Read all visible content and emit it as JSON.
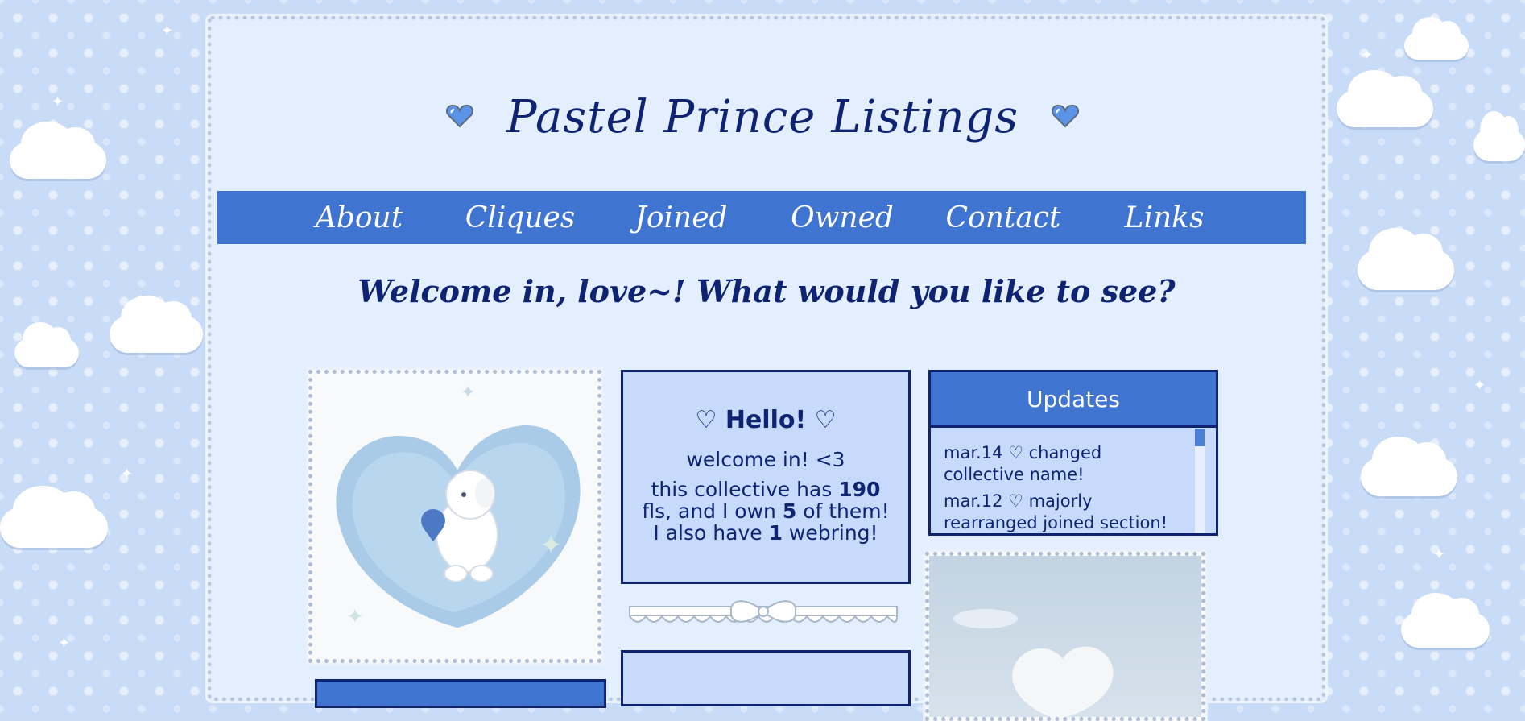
{
  "site": {
    "title": "Pastel Prince Listings"
  },
  "nav": {
    "items": [
      {
        "label": "About"
      },
      {
        "label": "Cliques"
      },
      {
        "label": "Joined"
      },
      {
        "label": "Owned"
      },
      {
        "label": "Contact"
      },
      {
        "label": "Links"
      }
    ]
  },
  "welcome": {
    "text": "Welcome in, love~! What would you like to see?"
  },
  "hello": {
    "title": "♡ Hello! ♡",
    "line1": "welcome in! <3",
    "stats_prefix": "this collective has ",
    "fls_count": "190",
    "stats_mid1": " fls, and I own ",
    "owned_count": "5",
    "stats_mid2": " of them! I also have ",
    "webring_count": "1",
    "stats_suffix": " webring!"
  },
  "updates": {
    "title": "Updates",
    "entries": [
      {
        "text": "mar.14 ♡ changed collective name!"
      },
      {
        "text": "mar.12 ♡ majorly rearranged joined section!"
      }
    ]
  },
  "colors": {
    "accent": "#3f74d1",
    "navy": "#0e2372",
    "panel": "#c7dafc",
    "frame": "#e3eefe"
  },
  "icons": {
    "title_decoration": "blue-heart-gem-icon",
    "divider": "bow-lace-icon"
  }
}
